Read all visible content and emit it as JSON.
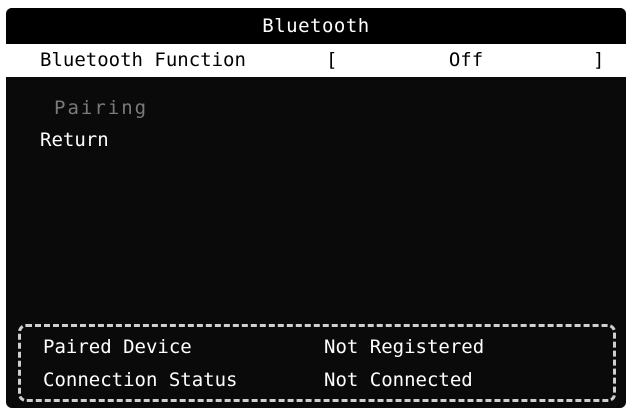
{
  "title": "Bluetooth",
  "menu": {
    "bluetooth_function": {
      "label": "Bluetooth Function",
      "bracket_open": "[",
      "value": "Off",
      "bracket_close": "]"
    },
    "pairing": {
      "label": "Pairing"
    },
    "return": {
      "label": "Return"
    }
  },
  "info": {
    "paired_device": {
      "label": "Paired Device",
      "value": "Not Registered"
    },
    "connection_status": {
      "label": "Connection Status",
      "value": "Not Connected"
    }
  },
  "colors": {
    "background": "#0a0a0a",
    "selected_row": "#ffffff",
    "disabled_text": "#7a7a7a",
    "dashed_border": "#cfcfcf"
  }
}
